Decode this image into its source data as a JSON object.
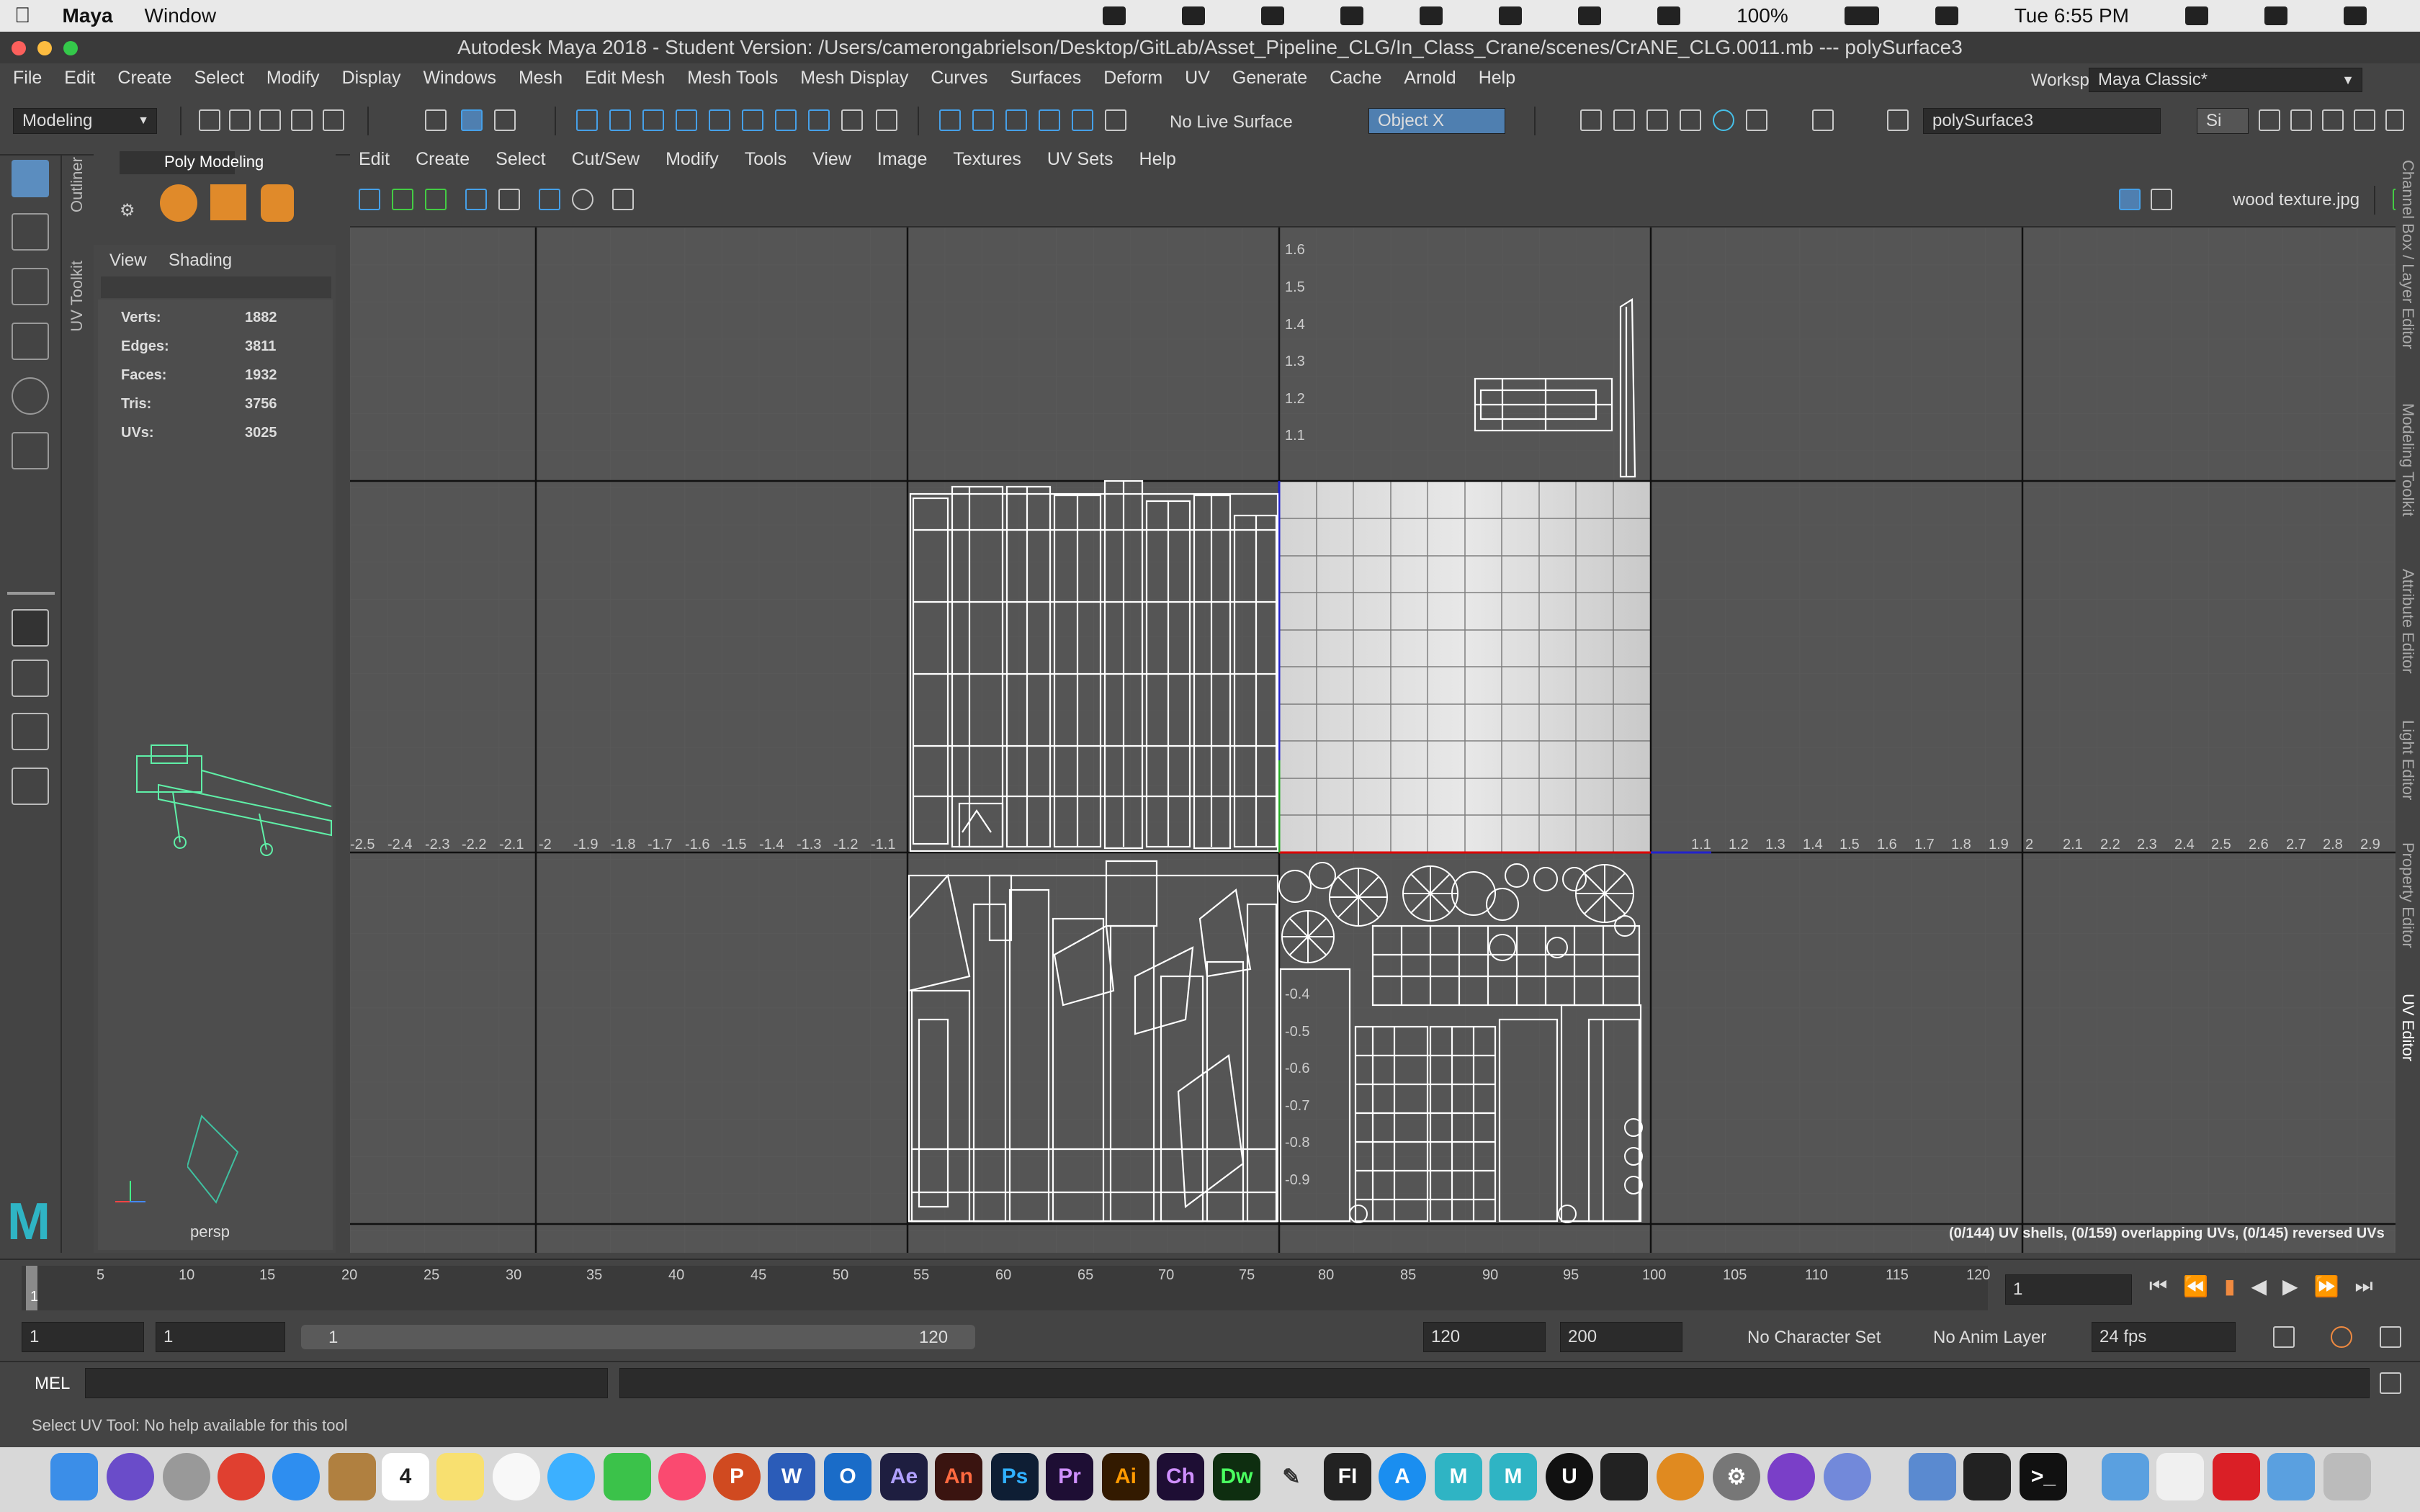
{
  "macos": {
    "app": "Maya",
    "menu": [
      "Window"
    ],
    "battery": "100%",
    "clock": "Tue 6:55 PM"
  },
  "window": {
    "title": "Autodesk Maya 2018 - Student Version: /Users/camerongabrielson/Desktop/GitLab/Asset_Pipeline_CLG/In_Class_Crane/scenes/CrANE_CLG.0011.mb  ---  polySurface3"
  },
  "menubar": [
    "File",
    "Edit",
    "Create",
    "Select",
    "Modify",
    "Display",
    "Windows",
    "Mesh",
    "Edit Mesh",
    "Mesh Tools",
    "Mesh Display",
    "Curves",
    "Surfaces",
    "Deform",
    "UV",
    "Generate",
    "Cache",
    "Arnold",
    "Help"
  ],
  "workspace": {
    "label": "Workspace :",
    "value": "Maya Classic*"
  },
  "shelf": {
    "mode": "Modeling",
    "live_surface": "No Live Surface",
    "symmetry": "Object X",
    "object_field": "polySurface3",
    "sign": "Si"
  },
  "left_tabs": {
    "outliner": "Outliner",
    "uv_toolkit": "UV Toolkit",
    "poly_modeling": "Poly Modeling"
  },
  "viewport": {
    "menu": [
      "View",
      "Shading"
    ],
    "stats": [
      {
        "label": "Verts:",
        "value": "1882"
      },
      {
        "label": "Edges:",
        "value": "3811"
      },
      {
        "label": "Faces:",
        "value": "1932"
      },
      {
        "label": "Tris:",
        "value": "3756"
      },
      {
        "label": "UVs:",
        "value": "3025"
      }
    ],
    "camera": "persp"
  },
  "uv_editor": {
    "menu": [
      "Edit",
      "Create",
      "Select",
      "Cut/Sew",
      "Modify",
      "Tools",
      "View",
      "Image",
      "Textures",
      "UV Sets",
      "Help"
    ],
    "texture": "wood texture.jpg",
    "status": "(0/144) UV shells, (0/159) overlapping UVs, (0/145) reversed UVs",
    "h_labels": [
      "-2.5",
      "-2.4",
      "-2.3",
      "-2.2",
      "-2.1",
      "-2",
      "-1.9",
      "-1.8",
      "-1.7",
      "-1.6",
      "-1.5",
      "-1.4",
      "-1.3",
      "-1.2",
      "-1.1",
      "1.1",
      "1.2",
      "1.3",
      "1.4",
      "1.5",
      "1.6",
      "1.7",
      "1.8",
      "1.9",
      "2",
      "2.1",
      "2.2",
      "2.3",
      "2.4",
      "2.5",
      "2.6",
      "2.7",
      "2.8",
      "2.9"
    ],
    "v_labels_top": [
      "1.6",
      "1.5",
      "1.4",
      "1.3",
      "1.2",
      "1.1"
    ],
    "v_labels_bottom": [
      "-0.4",
      "-0.5",
      "-0.6",
      "-0.7",
      "-0.8",
      "-0.9"
    ]
  },
  "right_tabs": [
    "Channel Box / Layer Editor",
    "Modeling Toolkit",
    "Attribute Editor",
    "Light Editor",
    "Property Editor",
    "UV Editor"
  ],
  "timeline": {
    "ticks": [
      "5",
      "10",
      "15",
      "20",
      "25",
      "30",
      "35",
      "40",
      "45",
      "50",
      "55",
      "60",
      "65",
      "70",
      "75",
      "80",
      "85",
      "90",
      "95",
      "100",
      "105",
      "110",
      "115",
      "120"
    ],
    "start": "1",
    "current_frame": "1"
  },
  "range": {
    "start": "1",
    "start2": "1",
    "slider_start": "1",
    "slider_end": "120",
    "end": "120",
    "end2": "200",
    "character_set": "No Character Set",
    "anim_layer": "No Anim Layer",
    "fps": "24 fps"
  },
  "command": {
    "label": "MEL"
  },
  "help_line": "Select UV Tool: No help available for this tool",
  "dock": [
    "Finder",
    "Siri",
    "Launchpad",
    "Chrome",
    "Safari",
    "Notes",
    "Calendar",
    "Stickies",
    "Photos",
    "Messages",
    "FaceTime",
    "Music",
    "PowerPoint",
    "Word",
    "Outlook",
    "Ae",
    "An",
    "Ps",
    "Pr",
    "Ai",
    "Ch",
    "Dw",
    "Pencil",
    "FI",
    "App Store",
    "Maya",
    "Mudbox",
    "Unreal",
    "Unity",
    "Blender",
    "Settings",
    "GitHub",
    "Discord",
    "Preview",
    "Console",
    "Terminal",
    "Folder",
    "Documents",
    "Creative Cloud",
    "Downloads",
    "Trash"
  ],
  "calendar_day": "4"
}
